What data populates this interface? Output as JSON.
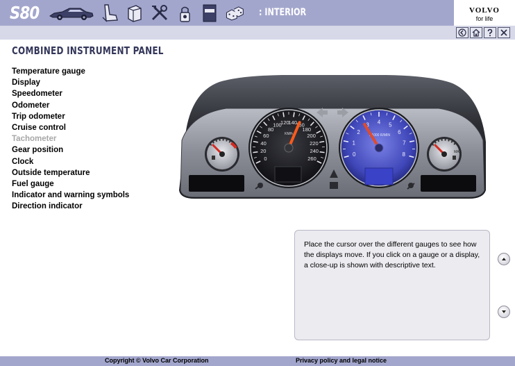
{
  "header": {
    "model": "S80",
    "section": ": INTERIOR",
    "brand_name": "VOLVO",
    "brand_tagline": "for life",
    "nav_icons": [
      "car-icon",
      "seat-icon",
      "book-icon",
      "tools-icon",
      "wheel-lock-icon",
      "manual-icon",
      "dice-icon"
    ],
    "manual_label": "VOLVO",
    "tool_buttons": [
      "back-icon",
      "home-icon",
      "help-icon",
      "close-icon"
    ]
  },
  "main": {
    "title": "COMBINED INSTRUMENT PANEL",
    "topics": [
      "Temperature gauge",
      "Display",
      "Speedometer",
      "Odometer",
      "Trip odometer",
      "Cruise control",
      "Tachometer",
      "Gear position",
      "Clock",
      "Outside temperature",
      "Fuel gauge",
      "Indicator and warning symbols",
      "Direction indicator"
    ],
    "active_topic_index": 6
  },
  "cluster": {
    "speed_ticks": [
      "0",
      "20",
      "40",
      "60",
      "80",
      "100",
      "120",
      "140",
      "160",
      "180",
      "200",
      "220",
      "240",
      "260"
    ],
    "speed_unit": "KM/h",
    "rpm_ticks": [
      "0",
      "1",
      "2",
      "3",
      "4",
      "5",
      "6",
      "7",
      "8"
    ],
    "rpm_unit": "X1000 R/MIN",
    "fuel_label": "MAX"
  },
  "info": {
    "text": "Place the cursor over the different gauges to see how the displays move. If you click on a gauge or a display, a close-up is shown with descriptive text."
  },
  "footer": {
    "copyright": "Copyright © Volvo Car Corporation",
    "privacy": "Privacy policy and legal notice"
  }
}
